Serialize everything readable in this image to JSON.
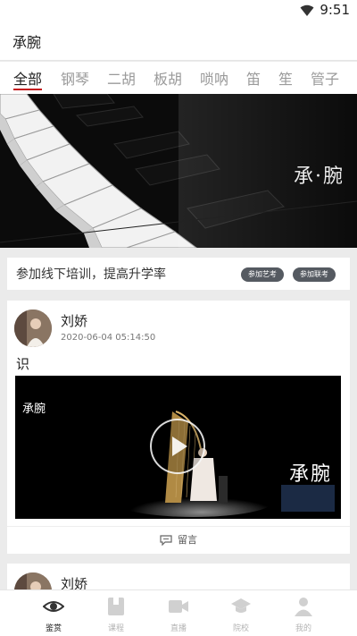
{
  "status_bar": {
    "time": "9:51"
  },
  "app": {
    "title": "承腕"
  },
  "tabs": [
    {
      "label": "全部",
      "active": true
    },
    {
      "label": "钢琴"
    },
    {
      "label": "二胡"
    },
    {
      "label": "板胡"
    },
    {
      "label": "唢呐"
    },
    {
      "label": "笛"
    },
    {
      "label": "笙"
    },
    {
      "label": "管子"
    }
  ],
  "banner": {
    "text": "承·腕"
  },
  "promo": {
    "text": "参加线下培训，提高升学率",
    "buttons": [
      "参加艺考",
      "参加联考"
    ]
  },
  "posts": [
    {
      "author": "刘娇",
      "time": "2020-06-04 05:14:50",
      "text": "识",
      "video": {
        "logo_left": "承腕",
        "logo_right": "承腕"
      },
      "comment_label": "留言"
    },
    {
      "author": "刘娇"
    }
  ],
  "bottom_nav": [
    {
      "label": "鉴赏",
      "icon": "eye-icon",
      "active": true
    },
    {
      "label": "课程",
      "icon": "book-icon"
    },
    {
      "label": "直播",
      "icon": "video-camera-icon"
    },
    {
      "label": "院校",
      "icon": "graduation-cap-icon"
    },
    {
      "label": "我的",
      "icon": "person-icon"
    }
  ],
  "colors": {
    "accent": "#c4161c",
    "pill": "#555a61",
    "inactive": "#b4b4b4"
  }
}
